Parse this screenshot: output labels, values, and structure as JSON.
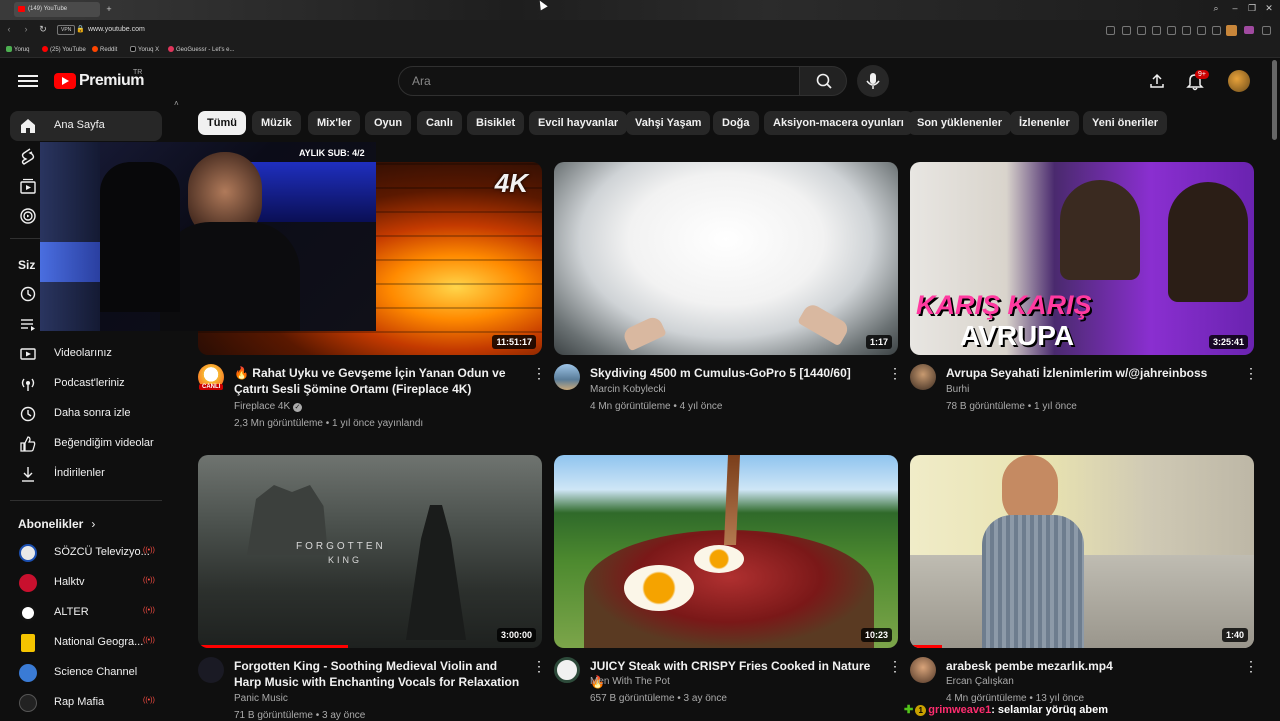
{
  "browser": {
    "tab_title": "(149) YouTube",
    "url": "www.youtube.com",
    "vpn_label": "VPN",
    "bookmarks": [
      "Yoruq",
      "(25) YouTube",
      "Reddit",
      "Yoruq X",
      "GeoGuessr - Let's e..."
    ]
  },
  "header": {
    "logo_text": "Premium",
    "logo_region": "TR",
    "search_placeholder": "Ara",
    "notification_count": "9+"
  },
  "sidebar": {
    "top_items": [
      {
        "label": "Ana Sayfa",
        "icon": "home-icon",
        "active": true
      },
      {
        "label": "",
        "icon": "shorts-icon"
      },
      {
        "label": "",
        "icon": "subscriptions-icon"
      },
      {
        "label": "",
        "icon": "youtube-music-icon"
      }
    ],
    "you_heading": "Siz",
    "you_items": [
      {
        "label": "",
        "icon": "history-icon"
      },
      {
        "label": "",
        "icon": "playlists-icon"
      },
      {
        "label": "Videolarınız",
        "icon": "your-videos-icon"
      },
      {
        "label": "Podcast'leriniz",
        "icon": "podcast-icon"
      },
      {
        "label": "Daha sonra izle",
        "icon": "watch-later-icon"
      },
      {
        "label": "Beğendiğim videolar",
        "icon": "liked-icon"
      },
      {
        "label": "İndirilenler",
        "icon": "download-icon"
      }
    ],
    "subs_heading": "Abonelikler",
    "subscriptions": [
      {
        "label": "SÖZCÜ Televizyo...",
        "color": "#e8e8e8"
      },
      {
        "label": "Halktv",
        "color": "#c8102e"
      },
      {
        "label": "ALTER",
        "color": "#ffffff"
      },
      {
        "label": "National Geogra...",
        "color": "#f5c400"
      },
      {
        "label": "Science Channel",
        "color": "#3a7bd5"
      },
      {
        "label": "Rap Mafia",
        "color": "#222222"
      }
    ]
  },
  "chips": [
    "Tümü",
    "Müzik",
    "Mix'ler",
    "Oyun",
    "Canlı",
    "Bisiklet",
    "Evcil hayvanlar",
    "Vahşi Yaşam",
    "Doğa",
    "Aksiyon-macera oyunları",
    "Son yüklenenler",
    "İzlenenler",
    "Yeni öneriler"
  ],
  "videos": [
    {
      "title": "🔥 Rahat Uyku ve Gevşeme İçin Yanan Odun ve Çatırtı Sesli Şömine Ortamı (Fireplace 4K)",
      "channel": "Fireplace 4K",
      "meta": "2,3 Mn görüntüleme • 1 yıl önce yayınlandı",
      "duration": "11:51:17",
      "thumb_badge": "4K",
      "avatar_label": "CANLI"
    },
    {
      "title": "Skydiving 4500 m  Cumulus-GoPro 5 [1440/60]",
      "channel": "Marcin Kobylecki",
      "meta": "4 Mn görüntüleme • 4 yıl önce",
      "duration": "1:17"
    },
    {
      "title": "Avrupa Seyahati İzlenimlerim w/@jahreinboss",
      "channel": "Burhi",
      "meta": "78 B görüntüleme • 1 yıl önce",
      "duration": "3:25:41",
      "thumb_text_1": "KARIŞ KARIŞ",
      "thumb_text_2": "AVRUPA"
    },
    {
      "title": "Forgotten King - Soothing Medieval Violin and Harp Music with Enchanting Vocals for Relaxation",
      "channel": "Panic Music",
      "meta": "71 B görüntüleme • 3 ay önce",
      "duration": "3:00:00",
      "thumb_text_1": "FORGOTTEN",
      "thumb_text_2": "KING"
    },
    {
      "title": "JUICY Steak with CRISPY Fries Cooked in Nature 🔥",
      "channel": "Men With The Pot",
      "meta": "657 B görüntüleme • 3 ay önce",
      "duration": "10:23"
    },
    {
      "title": "arabesk pembe mezarlık.mp4",
      "channel": "Ercan Çalışkan",
      "meta": "4 Mn görüntüleme • 13 yıl önce",
      "duration": "1:40"
    }
  ],
  "overlay": {
    "sub_counter": "AYLIK SUB: 4/2",
    "chat_badge": "1",
    "chat_user": "grimweave1",
    "chat_text": ": selamlar yörüq abem"
  },
  "colors": {
    "accent": "#ff0000",
    "background": "#0f0f0f",
    "chip": "#272727",
    "chat_user": "#ff2d6f",
    "chat_badge": "#52c41a"
  }
}
